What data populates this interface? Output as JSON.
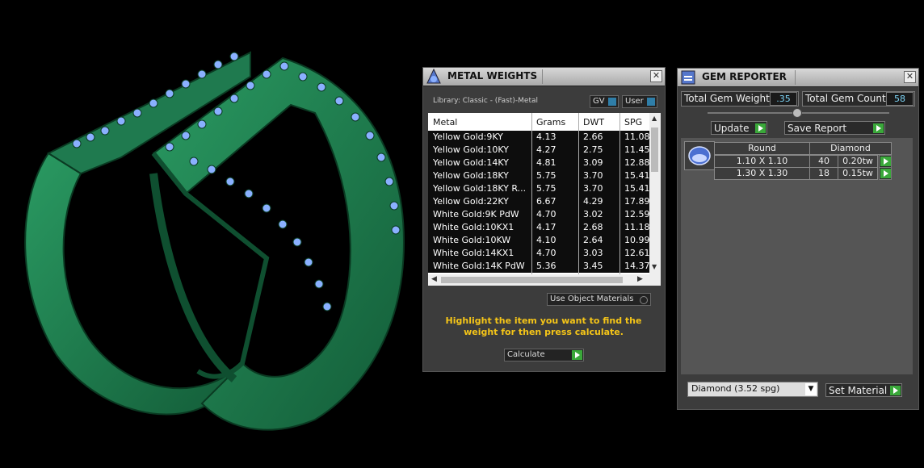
{
  "colors": {
    "ring": "#1f7a4f",
    "gem": "#8ab0ff",
    "accent_text": "#f5c518",
    "button_arrow": "#3aa83a"
  },
  "metal_weights": {
    "title": "METAL WEIGHTS",
    "close_icon": "close-icon",
    "library": "Library: Classic - (Fast)-Metal",
    "gv_label": "GV",
    "user_label": "User",
    "columns": [
      "Metal",
      "Grams",
      "DWT",
      "SPG"
    ],
    "rows": [
      [
        "Yellow Gold:9KY",
        "4.13",
        "2.66",
        "11.08"
      ],
      [
        "Yellow Gold:10KY",
        "4.27",
        "2.75",
        "11.45"
      ],
      [
        "Yellow Gold:14KY",
        "4.81",
        "3.09",
        "12.88"
      ],
      [
        "Yellow Gold:18KY",
        "5.75",
        "3.70",
        "15.41"
      ],
      [
        "Yellow Gold:18KY R...",
        "5.75",
        "3.70",
        "15.41"
      ],
      [
        "Yellow Gold:22KY",
        "6.67",
        "4.29",
        "17.89"
      ],
      [
        "White Gold:9K PdW",
        "4.70",
        "3.02",
        "12.59"
      ],
      [
        "White Gold:10KX1",
        "4.17",
        "2.68",
        "11.18"
      ],
      [
        "White Gold:10KW",
        "4.10",
        "2.64",
        "10.99"
      ],
      [
        "White Gold:14KX1",
        "4.70",
        "3.03",
        "12.61"
      ],
      [
        "White Gold:14K PdW",
        "5.36",
        "3.45",
        "14.37"
      ]
    ],
    "use_object_materials": "Use Object Materials",
    "hint": "Highlight the item you want to find the weight for then press calculate.",
    "calculate_label": "Calculate"
  },
  "gem_reporter": {
    "title": "GEM REPORTER",
    "total_weight_label": "Total Gem Weight",
    "total_weight_value": ".35",
    "total_count_label": "Total Gem Count",
    "total_count_value": "58",
    "update_label": "Update",
    "save_label": "Save Report",
    "shape_header": "Round",
    "material_header": "Diamond",
    "rows": [
      {
        "size": "1.10 X 1.10",
        "count": "40",
        "weight": "0.20tw"
      },
      {
        "size": "1.30 X 1.30",
        "count": "18",
        "weight": "0.15tw"
      }
    ],
    "material_select": "Diamond     (3.52 spg)",
    "set_material_label": "Set Material"
  }
}
